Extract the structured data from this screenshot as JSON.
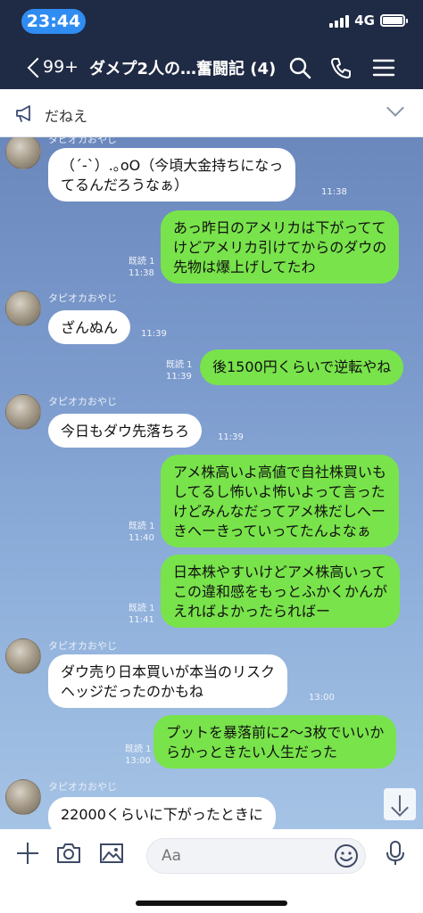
{
  "status": {
    "time": "23:44",
    "network": "4G"
  },
  "header": {
    "back_count": "99+",
    "title": "ダメプ2人の…奮闘記 (4)"
  },
  "notice": {
    "text": "だねえ"
  },
  "messages": [
    {
      "type": "in",
      "sender": "タピオカおやじ",
      "text": "（´-`）.｡oO（今頃大金持ちになっ\nてるんだろうなぁ）",
      "time": "11:38"
    },
    {
      "type": "out",
      "read": "既読 1",
      "text": "あっ昨日のアメリカは下がってて\nけどアメリカ引けてからのダウの\n先物は爆上げしてたわ",
      "time": "11:38"
    },
    {
      "type": "in",
      "sender": "タピオカおやじ",
      "text": "ざんぬん",
      "time": "11:39"
    },
    {
      "type": "out",
      "read": "既読 1",
      "text": "後1500円くらいで逆転やね",
      "time": "11:39"
    },
    {
      "type": "in",
      "sender": "タピオカおやじ",
      "text": "今日もダウ先落ちろ",
      "time": "11:39"
    },
    {
      "type": "out",
      "read": "既読 1",
      "text": "アメ株高いよ高値で自社株買いも\nしてるし怖いよ怖いよって言った\nけどみんなだってアメ株だしへー\nきへーきっていってたんよなぁ",
      "time": "11:40"
    },
    {
      "type": "out",
      "read": "既読 1",
      "text": "日本株やすいけどアメ株高いって\nこの違和感をもっとふかくかんが\nえればよかったらればー",
      "time": "11:41"
    },
    {
      "type": "in",
      "sender": "タピオカおやじ",
      "text": "ダウ売り日本買いが本当のリスク\nヘッジだったのかもね",
      "time": "13:00"
    },
    {
      "type": "out",
      "read": "既読 1",
      "text": "プットを暴落前に2〜3枚でいいか\nらかっときたい人生だった",
      "time": "13:00"
    },
    {
      "type": "in",
      "sender": "タピオカおやじ",
      "text": "22000くらいに下がったときに",
      "time": ""
    }
  ],
  "input": {
    "placeholder": "Aa"
  },
  "icons": {
    "back": "chevron-left-icon",
    "search": "search-icon",
    "call": "phone-icon",
    "menu": "menu-icon",
    "notice": "megaphone-icon",
    "plus": "plus-icon",
    "camera": "camera-icon",
    "image": "image-icon",
    "emoji": "emoji-icon",
    "mic": "microphone-icon",
    "scroll": "arrow-down-icon"
  },
  "colors": {
    "header": "#1f2a44",
    "time_pill": "#2f8cf0",
    "outgoing": "#79e34b",
    "incoming": "#ffffff"
  }
}
